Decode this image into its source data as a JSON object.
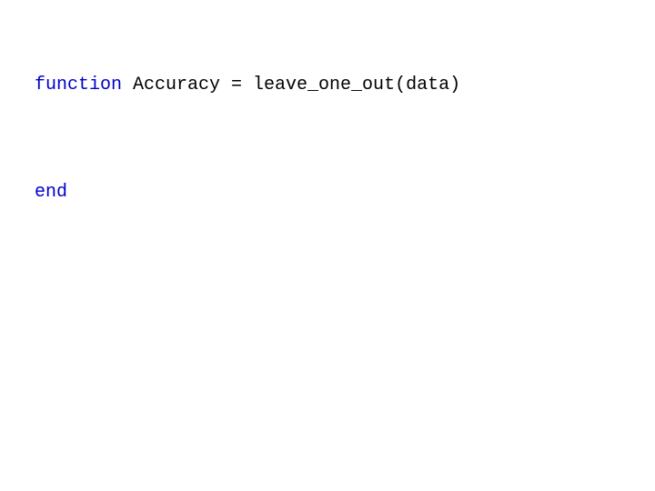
{
  "code": {
    "line1": {
      "kw": "function",
      "rest": " Accuracy = leave_one_out(data)"
    },
    "line2": {
      "kw": "end"
    }
  }
}
